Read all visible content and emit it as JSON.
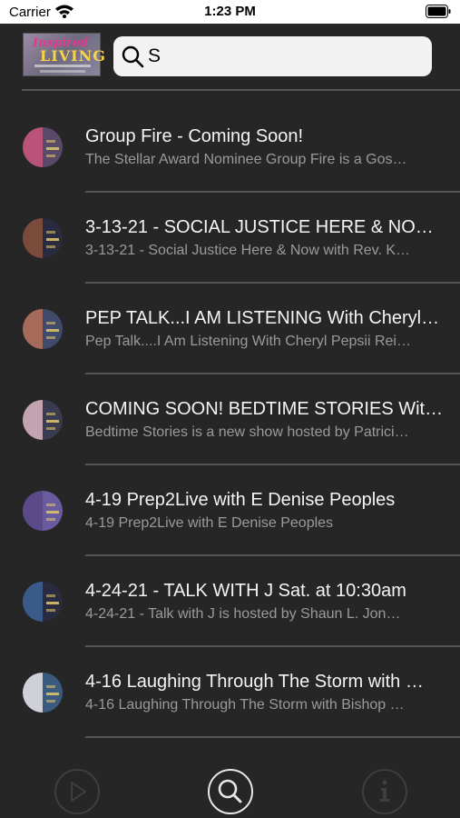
{
  "status_bar": {
    "carrier": "Carrier",
    "time": "1:23 PM"
  },
  "header": {
    "logo": {
      "line1": "Inspired",
      "line2": "LIVING"
    },
    "search": {
      "value": "S"
    }
  },
  "results": [
    {
      "title": "Group Fire - Coming Soon!",
      "subtitle": "The Stellar Award Nominee Group Fire is a Gos…",
      "avatar_colors": [
        "#b9537a",
        "#5a4a6a"
      ]
    },
    {
      "title": "3-13-21 - SOCIAL JUSTICE HERE & NO…",
      "subtitle": "3-13-21 - Social Justice Here & Now with Rev. K…",
      "avatar_colors": [
        "#7a4a3a",
        "#2a2a40"
      ]
    },
    {
      "title": "PEP TALK...I AM LISTENING With Cheryl…",
      "subtitle": "Pep Talk....I Am Listening With Cheryl Pepsii Rei…",
      "avatar_colors": [
        "#a66a5a",
        "#404a6a"
      ]
    },
    {
      "title": "COMING SOON! BEDTIME STORIES Wit…",
      "subtitle": "Bedtime Stories is a new show hosted by Patrici…",
      "avatar_colors": [
        "#c4a3b0",
        "#3a3a50"
      ]
    },
    {
      "title": "4-19 Prep2Live with E Denise Peoples",
      "subtitle": "4-19 Prep2Live with E Denise Peoples",
      "avatar_colors": [
        "#5a4a8a",
        "#6a5aa0"
      ]
    },
    {
      "title": "4-24-21 - TALK WITH J Sat. at 10:30am",
      "subtitle": "4-24-21 - Talk with J is hosted by Shaun L. Jon…",
      "avatar_colors": [
        "#3a5a8a",
        "#2a2a40"
      ]
    },
    {
      "title": "4-16 Laughing Through The Storm with …",
      "subtitle": "4-16 Laughing Through The Storm with Bishop …",
      "avatar_colors": [
        "#d0d0d8",
        "#3a5a80"
      ]
    }
  ],
  "tabbar": {
    "items": [
      {
        "name": "play",
        "icon": "play-icon",
        "active": false
      },
      {
        "name": "search",
        "icon": "search-icon",
        "active": true
      },
      {
        "name": "info",
        "icon": "info-icon",
        "active": false
      }
    ]
  },
  "colors": {
    "background": "#262626",
    "divider": "#555555",
    "title_text": "#f4f4f4",
    "subtitle_text": "#9a9a9a",
    "tab_active": "#e8e8e8",
    "tab_inactive": "#3e3e3e"
  }
}
